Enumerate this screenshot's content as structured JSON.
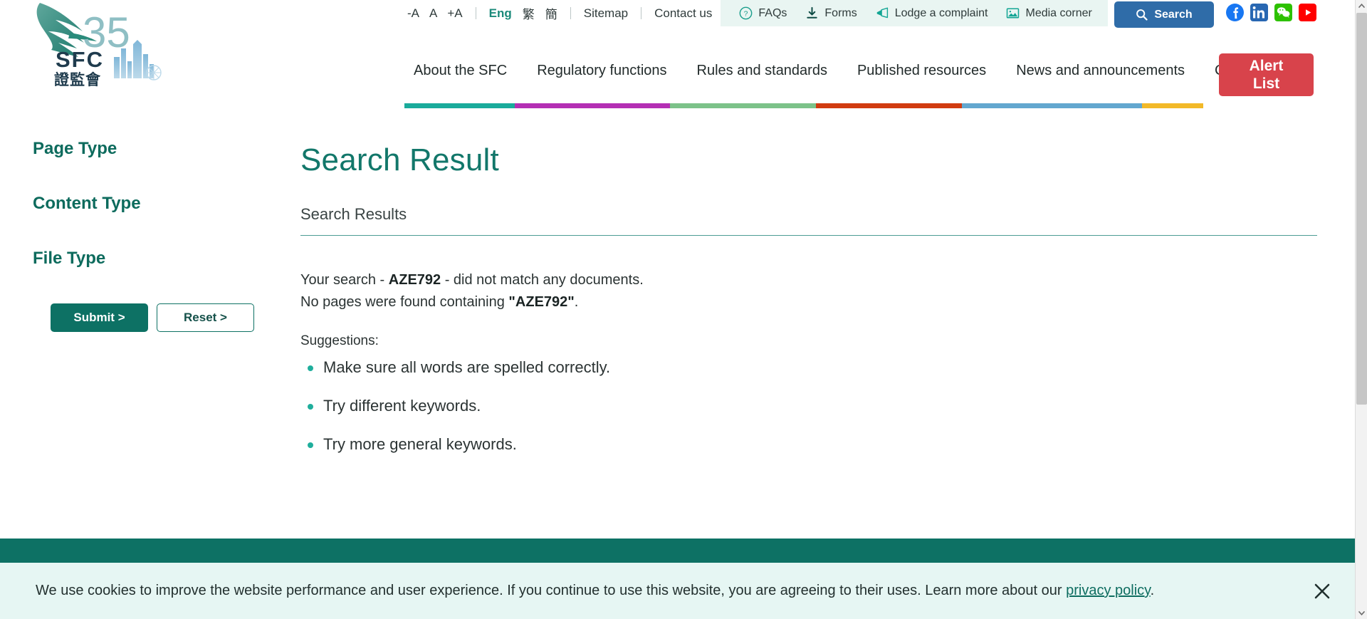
{
  "utility": {
    "font_size_controls": [
      {
        "label": "-A",
        "name": "decrease-font"
      },
      {
        "label": "A",
        "name": "normal-font"
      },
      {
        "label": "+A",
        "name": "increase-font"
      }
    ],
    "languages": [
      {
        "label": "Eng",
        "active": true
      },
      {
        "label": "繁",
        "active": false
      },
      {
        "label": "簡",
        "active": false
      }
    ],
    "sitemap": "Sitemap",
    "contact": "Contact us",
    "quick_links": [
      {
        "label": "FAQs",
        "icon": "question-circle-icon"
      },
      {
        "label": "Forms",
        "icon": "download-icon"
      },
      {
        "label": "Lodge a complaint",
        "icon": "megaphone-icon"
      },
      {
        "label": "Media corner",
        "icon": "image-icon"
      }
    ],
    "search_button": "Search",
    "social": [
      {
        "name": "facebook",
        "color": "#1877f2"
      },
      {
        "name": "linkedin",
        "color": "#2867b2"
      },
      {
        "name": "wechat",
        "color": "#2dc100"
      },
      {
        "name": "youtube",
        "color": "#ff0000"
      }
    ]
  },
  "brand": {
    "abbrev": "SFC",
    "chinese": "證監會",
    "anniversary": "35"
  },
  "nav": {
    "items": [
      {
        "label": "About the SFC",
        "color": "#1aab9b"
      },
      {
        "label": "Regulatory functions",
        "color": "#b42fb4"
      },
      {
        "label": "Rules and standards",
        "color": "#7cc289"
      },
      {
        "label": "Published resources",
        "color": "#d13b10"
      },
      {
        "label": "News and announcements",
        "color": "#63a7cf"
      },
      {
        "label": "Career",
        "color": "#f2b928"
      }
    ],
    "alert_list": "Alert\nList"
  },
  "sidebar": {
    "facets": [
      {
        "label": "Page Type"
      },
      {
        "label": "Content Type"
      },
      {
        "label": "File Type"
      }
    ],
    "submit_label": "Submit >",
    "reset_label": "Reset >"
  },
  "main": {
    "page_title": "Search Result",
    "results_label": "Search Results",
    "query": "AZE792",
    "no_match_prefix": "Your search - ",
    "no_match_suffix": " - did not match any documents.",
    "no_pages_prefix": "No pages were found containing ",
    "no_pages_query": "\"AZE792\"",
    "no_pages_suffix": ".",
    "suggestions_heading": "Suggestions:",
    "suggestions": [
      "Make sure all words are spelled correctly.",
      "Try different keywords.",
      "Try more general keywords."
    ]
  },
  "cookie": {
    "text": "We use cookies to improve the website performance and user experience. If you continue to use this website, you are agreeing to their uses. Learn more about our ",
    "link": "privacy policy",
    "tail": ".",
    "close_icon": "close-icon"
  },
  "colors": {
    "teal": "#0d7164",
    "teal_light": "#1fae9c",
    "search_blue": "#2f6ca8",
    "alert_red": "#d8434b",
    "cookie_bg": "#e6f6f3"
  }
}
